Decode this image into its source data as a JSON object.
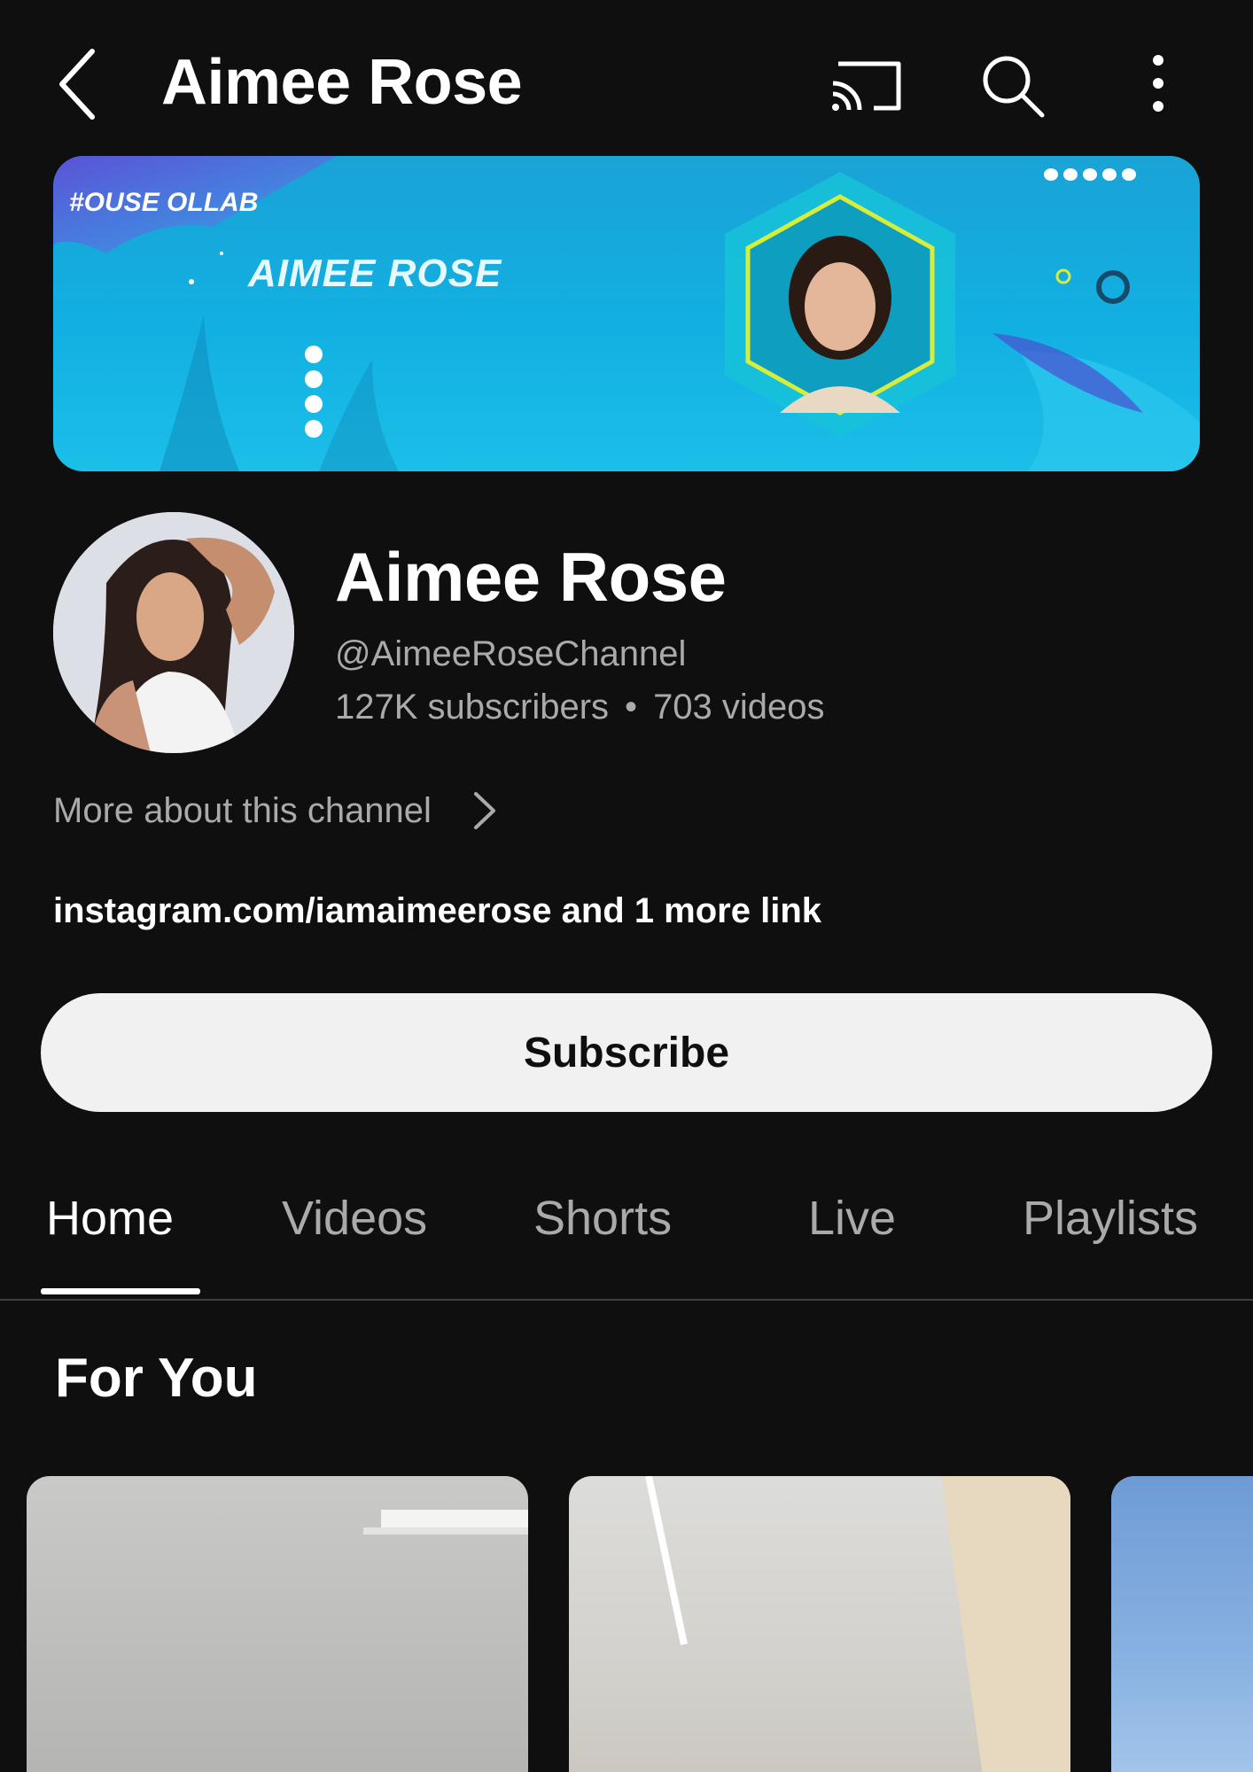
{
  "header": {
    "title": "Aimee Rose",
    "back_icon": "chevron-left-icon",
    "cast_icon": "cast-icon",
    "search_icon": "search-icon",
    "more_icon": "more-vert-icon"
  },
  "banner": {
    "name": "AIMEE ROSE",
    "logo": "#OUSE OLLAB"
  },
  "channel": {
    "name": "Aimee Rose",
    "handle": "@AimeeRoseChannel",
    "subscribers": "127K subscribers",
    "separator": "•",
    "videos": "703 videos",
    "more_about": "More about this channel",
    "links": "instagram.com/iamaimeerose and 1 more link"
  },
  "subscribe": {
    "label": "Subscribe"
  },
  "tabs": [
    {
      "label": "Home",
      "active": true
    },
    {
      "label": "Videos",
      "active": false
    },
    {
      "label": "Shorts",
      "active": false
    },
    {
      "label": "Live",
      "active": false
    },
    {
      "label": "Playlists",
      "active": false
    }
  ],
  "section": {
    "title": "For You"
  },
  "colors": {
    "background": "#0f0f0f",
    "text_primary": "#ffffff",
    "text_secondary": "#aaaaaa",
    "subscribe_bg": "#f1f1f1",
    "banner_blue": "#12b0e2"
  }
}
